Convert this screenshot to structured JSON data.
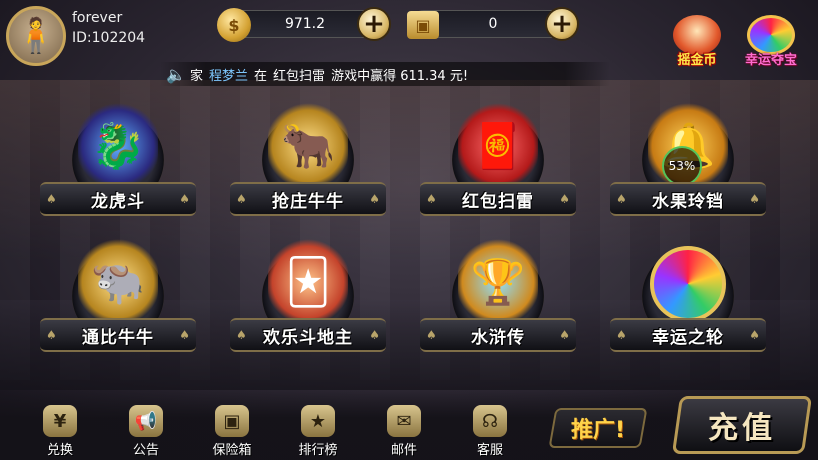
{
  "user": {
    "name": "forever",
    "id": "ID:102204"
  },
  "currency": {
    "coins": {
      "icon": "coin-icon",
      "value": "971.2"
    },
    "tickets": {
      "icon": "safe-ticket-icon",
      "value": "0"
    }
  },
  "top_right": [
    {
      "label": "摇金币",
      "icon": "god-of-wealth-icon"
    },
    {
      "label": "幸运夺宝",
      "icon": "lucky-wheel-icon"
    }
  ],
  "marquee": {
    "prefix": "家",
    "player": "程梦兰",
    "mid": "在",
    "game": "红包扫雷",
    "rest": "游戏中赢得 611.34 元!"
  },
  "games": [
    {
      "name": "龙虎斗",
      "icon": "dragon-tiger-icon"
    },
    {
      "name": "抢庄牛牛",
      "icon": "golden-bull-icon"
    },
    {
      "name": "红包扫雷",
      "icon": "red-envelope-icon"
    },
    {
      "name": "水果玲铛",
      "icon": "fruit-bell-icon",
      "progress": "53%"
    },
    {
      "name": "通比牛牛",
      "icon": "bull-cards-icon"
    },
    {
      "name": "欢乐斗地主",
      "icon": "landlord-cards-icon"
    },
    {
      "name": "水浒传",
      "icon": "water-margin-icon"
    },
    {
      "name": "幸运之轮",
      "icon": "fortune-wheel-icon"
    }
  ],
  "bottom_nav": [
    {
      "label": "兑换",
      "icon": "exchange-icon"
    },
    {
      "label": "公告",
      "icon": "megaphone-icon"
    },
    {
      "label": "保险箱",
      "icon": "safe-icon"
    },
    {
      "label": "排行榜",
      "icon": "leaderboard-icon"
    },
    {
      "label": "邮件",
      "icon": "mail-icon"
    },
    {
      "label": "客服",
      "icon": "headset-icon"
    }
  ],
  "promo_label": "推广!",
  "recharge_label": "充值"
}
